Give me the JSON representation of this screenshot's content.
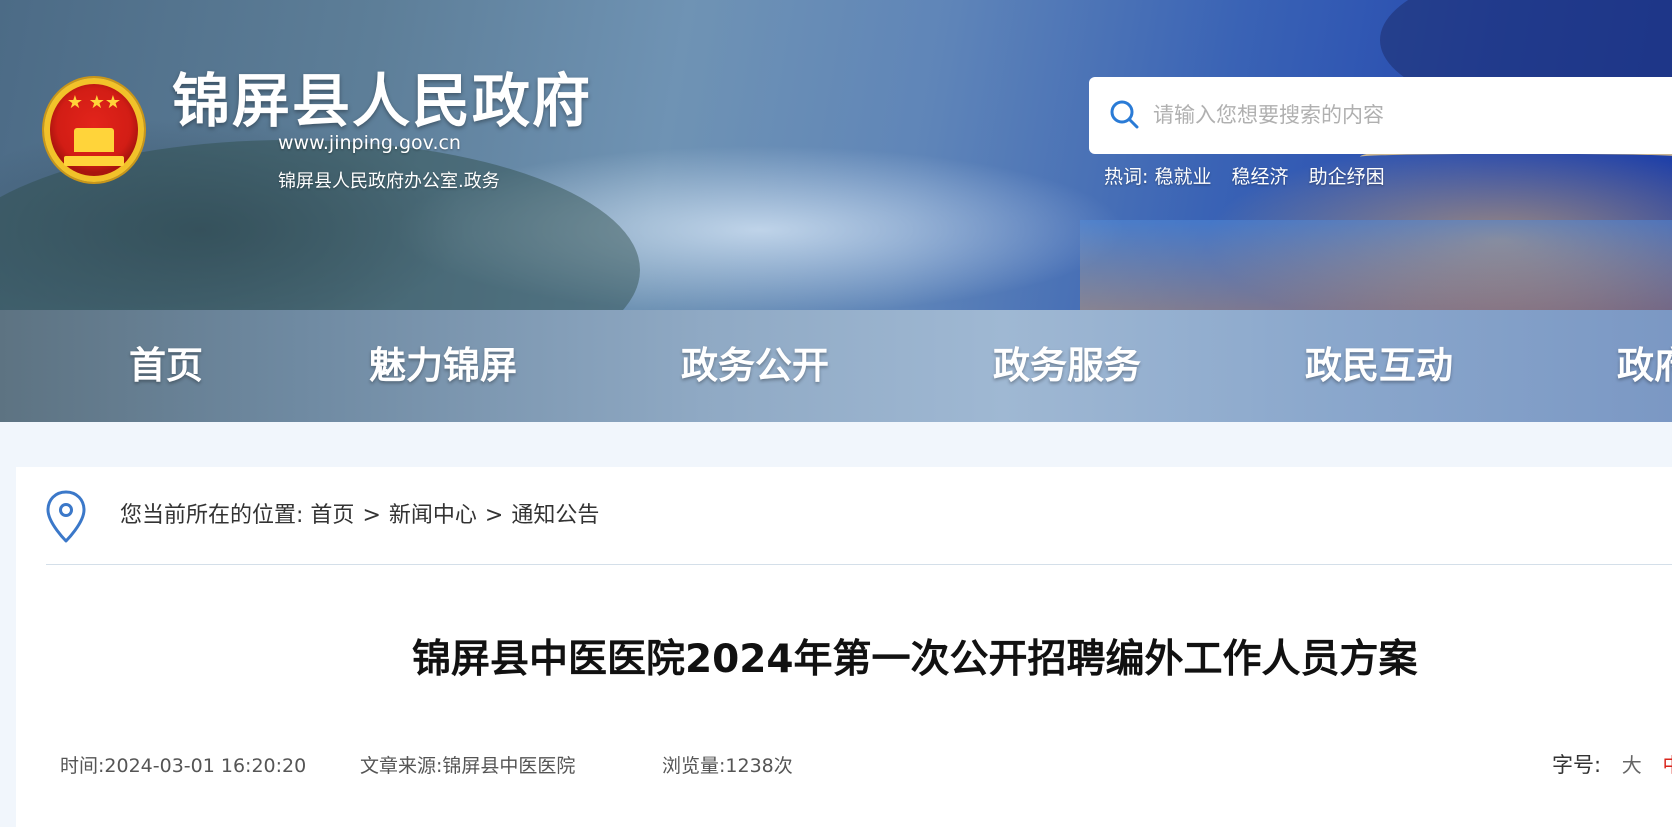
{
  "header": {
    "site_title": "锦屏县人民政府",
    "site_url": "www.jinping.gov.cn",
    "office_line": "锦屏县人民政府办公室.政务",
    "emblem_stars": "★ ★★",
    "search": {
      "placeholder": "请输入您想要搜索的内容"
    },
    "hotwords": {
      "label": "热词:",
      "items": [
        "稳就业",
        "稳经济",
        "助企纾困"
      ]
    }
  },
  "nav": {
    "items": [
      "首页",
      "魅力锦屏",
      "政务公开",
      "政务服务",
      "政民互动",
      "政府"
    ]
  },
  "breadcrumb": {
    "prefix": "您当前所在的位置:",
    "items": [
      "首页",
      "新闻中心",
      "通知公告"
    ],
    "separator": ">"
  },
  "article": {
    "title": "锦屏县中医医院2024年第一次公开招聘编外工作人员方案",
    "time": "时间:2024-03-01 16:20:20",
    "source": "文章来源:锦屏县中医医院",
    "views": "浏览量:1238次",
    "font_size_label": "字号:",
    "font_size_options": [
      "大",
      "中"
    ]
  },
  "colors": {
    "accent": "#1a56c6",
    "active_font_option": "#d9261c",
    "page_background": "#f1f6fc"
  }
}
